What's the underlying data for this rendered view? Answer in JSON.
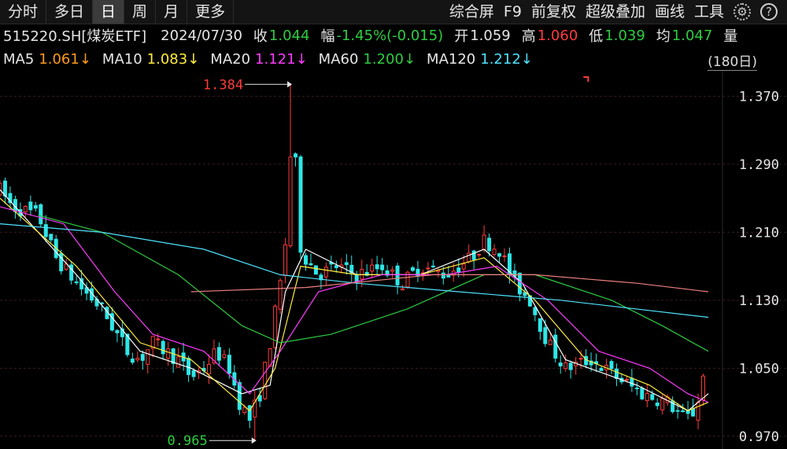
{
  "toolbar": {
    "tabs": [
      {
        "label": "分时",
        "active": false
      },
      {
        "label": "多日",
        "active": false
      },
      {
        "label": "日",
        "active": true
      },
      {
        "label": "周",
        "active": false
      },
      {
        "label": "月",
        "active": false
      },
      {
        "label": "更多",
        "active": false
      }
    ],
    "tools": [
      "综合屏",
      "F9",
      "前复权",
      "超级叠加",
      "画线",
      "工具"
    ],
    "settings_icon": "gear-icon",
    "help_icon": "help-icon",
    "help_glyph": "?"
  },
  "info": {
    "security": "515220.SH[煤炭ETF]",
    "date": "2024/07/30",
    "close_label": "收",
    "close": "1.044",
    "change_label": "幅",
    "change": "-1.45%(-0.015)",
    "open_label": "开",
    "open": "1.059",
    "high_label": "高",
    "high": "1.060",
    "low_label": "低",
    "low": "1.039",
    "avg_label": "均",
    "avg": "1.047",
    "more_label": "量"
  },
  "ma": [
    {
      "label": "MA5",
      "value": "1.061↓",
      "color": "#ff9a1a"
    },
    {
      "label": "MA10",
      "value": "1.083↓",
      "color": "#ffeb3b"
    },
    {
      "label": "MA20",
      "value": "1.121↓",
      "color": "#ff3bff"
    },
    {
      "label": "MA60",
      "value": "1.200↓",
      "color": "#2ecc40"
    },
    {
      "label": "MA120",
      "value": "1.212↓",
      "color": "#4fe3ff"
    }
  ],
  "range_label": "(180日)",
  "colors": {
    "up": "#ff3b3b",
    "down": "#2ee6e6",
    "grid": "#3a1c1c",
    "ma5": "#ffffff",
    "ma10": "#ffeb3b",
    "ma20": "#ff3bff",
    "ma60": "#2ecc40",
    "ma120": "#4fe3ff",
    "ma_long": "#f08080"
  },
  "chart_data": {
    "type": "candlestick",
    "ylim": [
      0.955,
      1.4
    ],
    "yticks": [
      "1.370",
      "1.290",
      "1.210",
      "1.130",
      "1.050",
      "0.970"
    ],
    "annotations": [
      {
        "text": "1.384",
        "value": 1.384,
        "kind": "max"
      },
      {
        "text": "0.965",
        "value": 0.965,
        "kind": "min"
      }
    ],
    "price_path": [
      [
        0,
        1.26
      ],
      [
        5,
        1.24
      ],
      [
        15,
        1.23
      ],
      [
        22,
        1.18
      ],
      [
        30,
        1.15
      ],
      [
        40,
        1.12
      ],
      [
        50,
        1.07
      ],
      [
        55,
        1.06
      ],
      [
        60,
        1.08
      ],
      [
        65,
        1.07
      ],
      [
        70,
        1.06
      ],
      [
        75,
        1.04
      ],
      [
        80,
        1.05
      ],
      [
        85,
        1.07
      ],
      [
        90,
        1.05
      ],
      [
        94,
        1.01
      ],
      [
        98,
        0.99
      ],
      [
        102,
        1.02
      ],
      [
        106,
        1.08
      ],
      [
        110,
        1.15
      ],
      [
        113,
        1.22
      ],
      [
        115,
        1.38
      ],
      [
        117,
        1.2
      ],
      [
        120,
        1.18
      ],
      [
        125,
        1.16
      ],
      [
        132,
        1.17
      ],
      [
        140,
        1.16
      ],
      [
        150,
        1.17
      ],
      [
        158,
        1.15
      ],
      [
        165,
        1.17
      ],
      [
        175,
        1.16
      ],
      [
        185,
        1.18
      ],
      [
        190,
        1.2
      ],
      [
        196,
        1.19
      ],
      [
        202,
        1.15
      ],
      [
        208,
        1.13
      ],
      [
        215,
        1.08
      ],
      [
        222,
        1.05
      ],
      [
        232,
        1.06
      ],
      [
        242,
        1.04
      ],
      [
        252,
        1.02
      ],
      [
        262,
        1.01
      ],
      [
        269,
        0.99
      ],
      [
        273,
        1.0
      ],
      [
        276,
        1.04
      ]
    ],
    "ma_series": [
      {
        "name": "MA5",
        "points": [
          [
            0,
            1.26
          ],
          [
            30,
            1.16
          ],
          [
            55,
            1.07
          ],
          [
            75,
            1.05
          ],
          [
            95,
            1.02
          ],
          [
            106,
            1.03
          ],
          [
            112,
            1.14
          ],
          [
            120,
            1.19
          ],
          [
            140,
            1.16
          ],
          [
            165,
            1.16
          ],
          [
            190,
            1.19
          ],
          [
            205,
            1.15
          ],
          [
            222,
            1.06
          ],
          [
            250,
            1.03
          ],
          [
            270,
            1.0
          ],
          [
            278,
            1.02
          ]
        ]
      },
      {
        "name": "MA10",
        "points": [
          [
            0,
            1.25
          ],
          [
            30,
            1.17
          ],
          [
            55,
            1.08
          ],
          [
            75,
            1.06
          ],
          [
            98,
            1.0
          ],
          [
            108,
            1.05
          ],
          [
            118,
            1.17
          ],
          [
            140,
            1.16
          ],
          [
            165,
            1.16
          ],
          [
            190,
            1.18
          ],
          [
            210,
            1.13
          ],
          [
            230,
            1.06
          ],
          [
            255,
            1.03
          ],
          [
            270,
            1.0
          ],
          [
            278,
            1.01
          ]
        ]
      },
      {
        "name": "MA20",
        "points": [
          [
            0,
            1.24
          ],
          [
            25,
            1.22
          ],
          [
            45,
            1.14
          ],
          [
            60,
            1.09
          ],
          [
            80,
            1.07
          ],
          [
            98,
            1.02
          ],
          [
            110,
            1.07
          ],
          [
            125,
            1.14
          ],
          [
            150,
            1.16
          ],
          [
            175,
            1.16
          ],
          [
            195,
            1.17
          ],
          [
            215,
            1.13
          ],
          [
            235,
            1.07
          ],
          [
            255,
            1.05
          ],
          [
            270,
            1.02
          ],
          [
            278,
            1.01
          ]
        ]
      },
      {
        "name": "MA60",
        "points": [
          [
            15,
            1.23
          ],
          [
            40,
            1.21
          ],
          [
            70,
            1.16
          ],
          [
            95,
            1.1
          ],
          [
            110,
            1.08
          ],
          [
            130,
            1.09
          ],
          [
            160,
            1.12
          ],
          [
            190,
            1.16
          ],
          [
            210,
            1.16
          ],
          [
            240,
            1.13
          ],
          [
            260,
            1.1
          ],
          [
            278,
            1.07
          ]
        ]
      },
      {
        "name": "MA120",
        "points": [
          [
            0,
            1.22
          ],
          [
            40,
            1.21
          ],
          [
            80,
            1.19
          ],
          [
            110,
            1.16
          ],
          [
            140,
            1.15
          ],
          [
            180,
            1.14
          ],
          [
            220,
            1.13
          ],
          [
            278,
            1.11
          ]
        ]
      },
      {
        "name": "MA-long",
        "points": [
          [
            75,
            1.14
          ],
          [
            120,
            1.145
          ],
          [
            170,
            1.16
          ],
          [
            210,
            1.16
          ],
          [
            250,
            1.15
          ],
          [
            278,
            1.14
          ]
        ]
      }
    ]
  }
}
